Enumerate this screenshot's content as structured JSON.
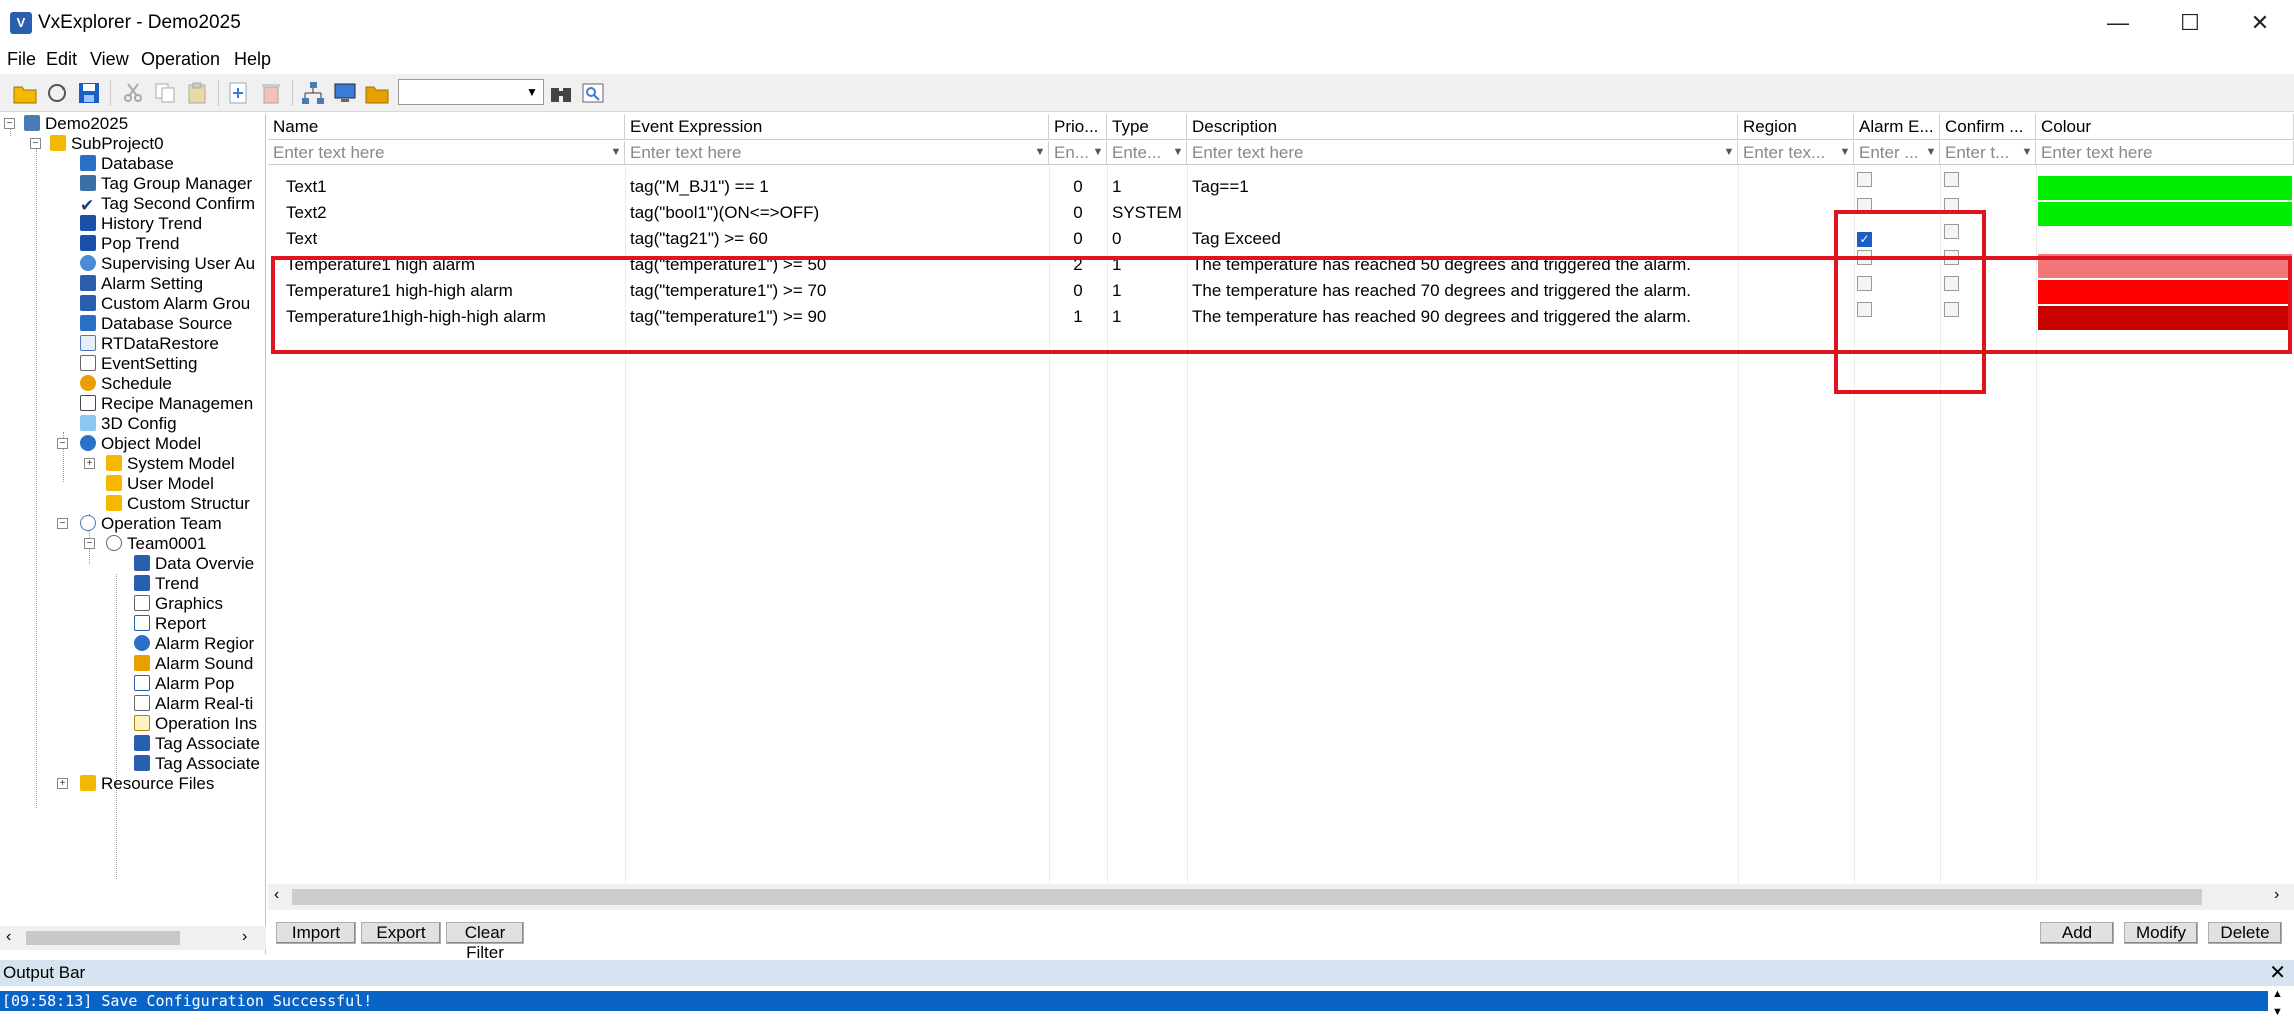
{
  "window": {
    "title": "VxExplorer - Demo2025"
  },
  "menu": {
    "items": [
      "File",
      "Edit",
      "View",
      "Operation",
      "Help"
    ]
  },
  "toolbar": {
    "combo_value": ""
  },
  "tree": {
    "nodes": [
      {
        "label": "Demo2025",
        "icon": "project-icon"
      },
      {
        "label": "SubProject0",
        "icon": "folder-icon"
      },
      {
        "label": "Database",
        "icon": "database-icon"
      },
      {
        "label": "Tag Group Manager",
        "icon": "tag-group-icon"
      },
      {
        "label": "Tag Second Confirm",
        "icon": "checkmark-icon"
      },
      {
        "label": "History Trend",
        "icon": "history-trend-icon"
      },
      {
        "label": "Pop Trend",
        "icon": "pop-trend-icon"
      },
      {
        "label": "Supervising User Au",
        "icon": "user-icon"
      },
      {
        "label": "Alarm Setting",
        "icon": "alarm-setting-icon"
      },
      {
        "label": "Custom Alarm Grou",
        "icon": "custom-alarm-icon"
      },
      {
        "label": "Database Source",
        "icon": "database-source-icon"
      },
      {
        "label": "RTDataRestore",
        "icon": "restore-icon"
      },
      {
        "label": "EventSetting",
        "icon": "event-setting-icon"
      },
      {
        "label": "Schedule",
        "icon": "schedule-icon"
      },
      {
        "label": "Recipe Managemen",
        "icon": "recipe-icon"
      },
      {
        "label": "3D Config",
        "icon": "cube-icon"
      },
      {
        "label": "Object Model",
        "icon": "object-model-icon"
      },
      {
        "label": "System Model",
        "icon": "folder-icon"
      },
      {
        "label": "User Model",
        "icon": "folder-icon"
      },
      {
        "label": "Custom Structur",
        "icon": "folder-icon"
      },
      {
        "label": "Operation Team",
        "icon": "team-icon"
      },
      {
        "label": "Team0001",
        "icon": "team-member-icon"
      },
      {
        "label": "Data Overvie",
        "icon": "data-overview-icon"
      },
      {
        "label": "Trend",
        "icon": "trend-icon"
      },
      {
        "label": "Graphics",
        "icon": "graphics-icon"
      },
      {
        "label": "Report",
        "icon": "report-icon"
      },
      {
        "label": "Alarm Regior",
        "icon": "alarm-region-icon"
      },
      {
        "label": "Alarm Sound",
        "icon": "speaker-icon"
      },
      {
        "label": "Alarm Pop",
        "icon": "alarm-pop-icon"
      },
      {
        "label": "Alarm Real-ti",
        "icon": "alarm-realtime-icon"
      },
      {
        "label": "Operation Ins",
        "icon": "operation-ins-icon"
      },
      {
        "label": "Tag Associate",
        "icon": "tag-associate-icon"
      },
      {
        "label": "Tag Associate",
        "icon": "tag-associate-icon"
      },
      {
        "label": "Resource Files",
        "icon": "resource-files-icon"
      }
    ]
  },
  "grid": {
    "columns": [
      "Name",
      "Event Expression",
      "Prio...",
      "Type",
      "Description",
      "Region",
      "Alarm E...",
      "Confirm ...",
      "Colour"
    ],
    "filters": [
      "Enter text here",
      "Enter text here",
      "En...",
      "Ente...",
      "Enter text here",
      "Enter tex...",
      "Enter ...",
      "Enter t...",
      "Enter text here"
    ],
    "rows": [
      {
        "name": "Text1",
        "expr": "tag(\"M_BJ1\") == 1",
        "prio": "0",
        "type": "1",
        "desc": "Tag==1",
        "region": "",
        "alarm": false,
        "confirm": false,
        "colour": "#00ee00"
      },
      {
        "name": "Text2",
        "expr": "tag(\"bool1\")(ON<=>OFF)",
        "prio": "0",
        "type": "SYSTEM",
        "desc": "",
        "region": "",
        "alarm": false,
        "confirm": false,
        "colour": "#00ee00"
      },
      {
        "name": "Text",
        "expr": "tag(\"tag21\") >= 60",
        "prio": "0",
        "type": "0",
        "desc": "Tag Exceed",
        "region": "",
        "alarm": true,
        "confirm": false,
        "colour": ""
      },
      {
        "name": "Temperature1 high alarm",
        "expr": "tag(\"temperature1\") >= 50",
        "prio": "2",
        "type": "1",
        "desc": "The temperature has reached 50 degrees and triggered the alarm.",
        "region": "",
        "alarm": false,
        "confirm": false,
        "colour": "#f07878"
      },
      {
        "name": "Temperature1 high-high alarm",
        "expr": "tag(\"temperature1\") >= 70",
        "prio": "0",
        "type": "1",
        "desc": "The temperature has reached 70 degrees and triggered the alarm.",
        "region": "",
        "alarm": false,
        "confirm": false,
        "colour": "#ff0000"
      },
      {
        "name": "Temperature1high-high-high alarm",
        "expr": "tag(\"temperature1\") >= 90",
        "prio": "1",
        "type": "1",
        "desc": "The temperature has reached 90 degrees and triggered the alarm.",
        "region": "",
        "alarm": false,
        "confirm": false,
        "colour": "#c80000"
      }
    ]
  },
  "buttons": {
    "import": "Import",
    "export": "Export",
    "clear_filter": "Clear Filter",
    "add": "Add",
    "modify": "Modify",
    "delete": "Delete"
  },
  "output": {
    "title": "Output Bar",
    "message": "[09:58:13] Save Configuration Successful!"
  },
  "colors": {
    "highlight_red": "#e0141e",
    "selection_blue": "#0a64c8"
  }
}
